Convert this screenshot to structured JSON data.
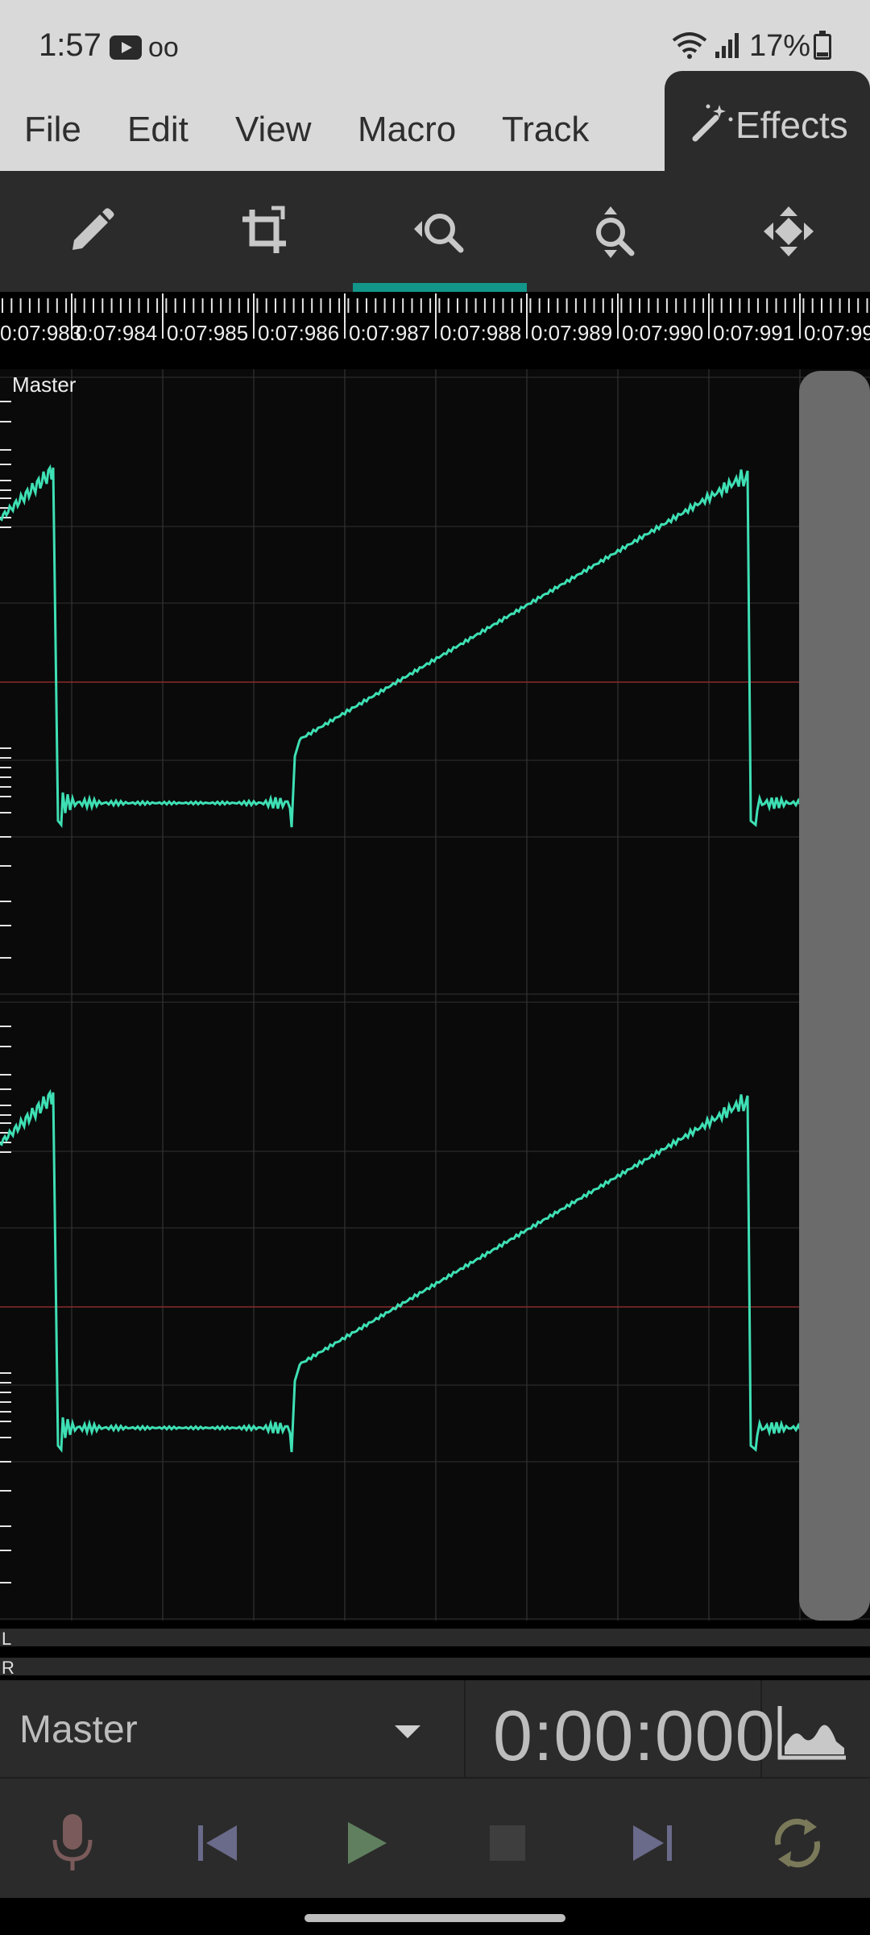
{
  "status_bar": {
    "time": "1:57",
    "battery": "17%",
    "icons": [
      "youtube-icon",
      "voicemail-icon",
      "wifi-icon",
      "signal-icon",
      "battery-icon"
    ]
  },
  "menu": {
    "file": "File",
    "edit": "Edit",
    "view": "View",
    "macro": "Macro",
    "track": "Track",
    "effects": "Effects"
  },
  "toolbar": {
    "tools": [
      "draw-tool-icon",
      "selection-tool-icon",
      "zoom-horizontal-tool-icon",
      "zoom-vertical-tool-icon",
      "move-tool-icon"
    ],
    "active_tool": "zoom-horizontal-tool-icon",
    "accent_color": "#13968a"
  },
  "timeline": {
    "labels": [
      "0:07:983",
      "0:07:984",
      "0:07:985",
      "0:07:986",
      "0:07:987",
      "0:07:988",
      "0:07:989",
      "0:07:990",
      "0:07:991",
      "0:07:99"
    ]
  },
  "waveform": {
    "track_name": "Master",
    "channel_left_label": "L",
    "channel_right_label": "R",
    "wave_color": "#3ee0b4",
    "center_line_color": "#8a2a2a"
  },
  "bottom": {
    "selected_track": "Master",
    "time_value": "0:00:000"
  },
  "transport": {
    "buttons": [
      "record-icon",
      "skip-back-icon",
      "play-icon",
      "stop-icon",
      "skip-forward-icon",
      "loop-icon"
    ]
  }
}
